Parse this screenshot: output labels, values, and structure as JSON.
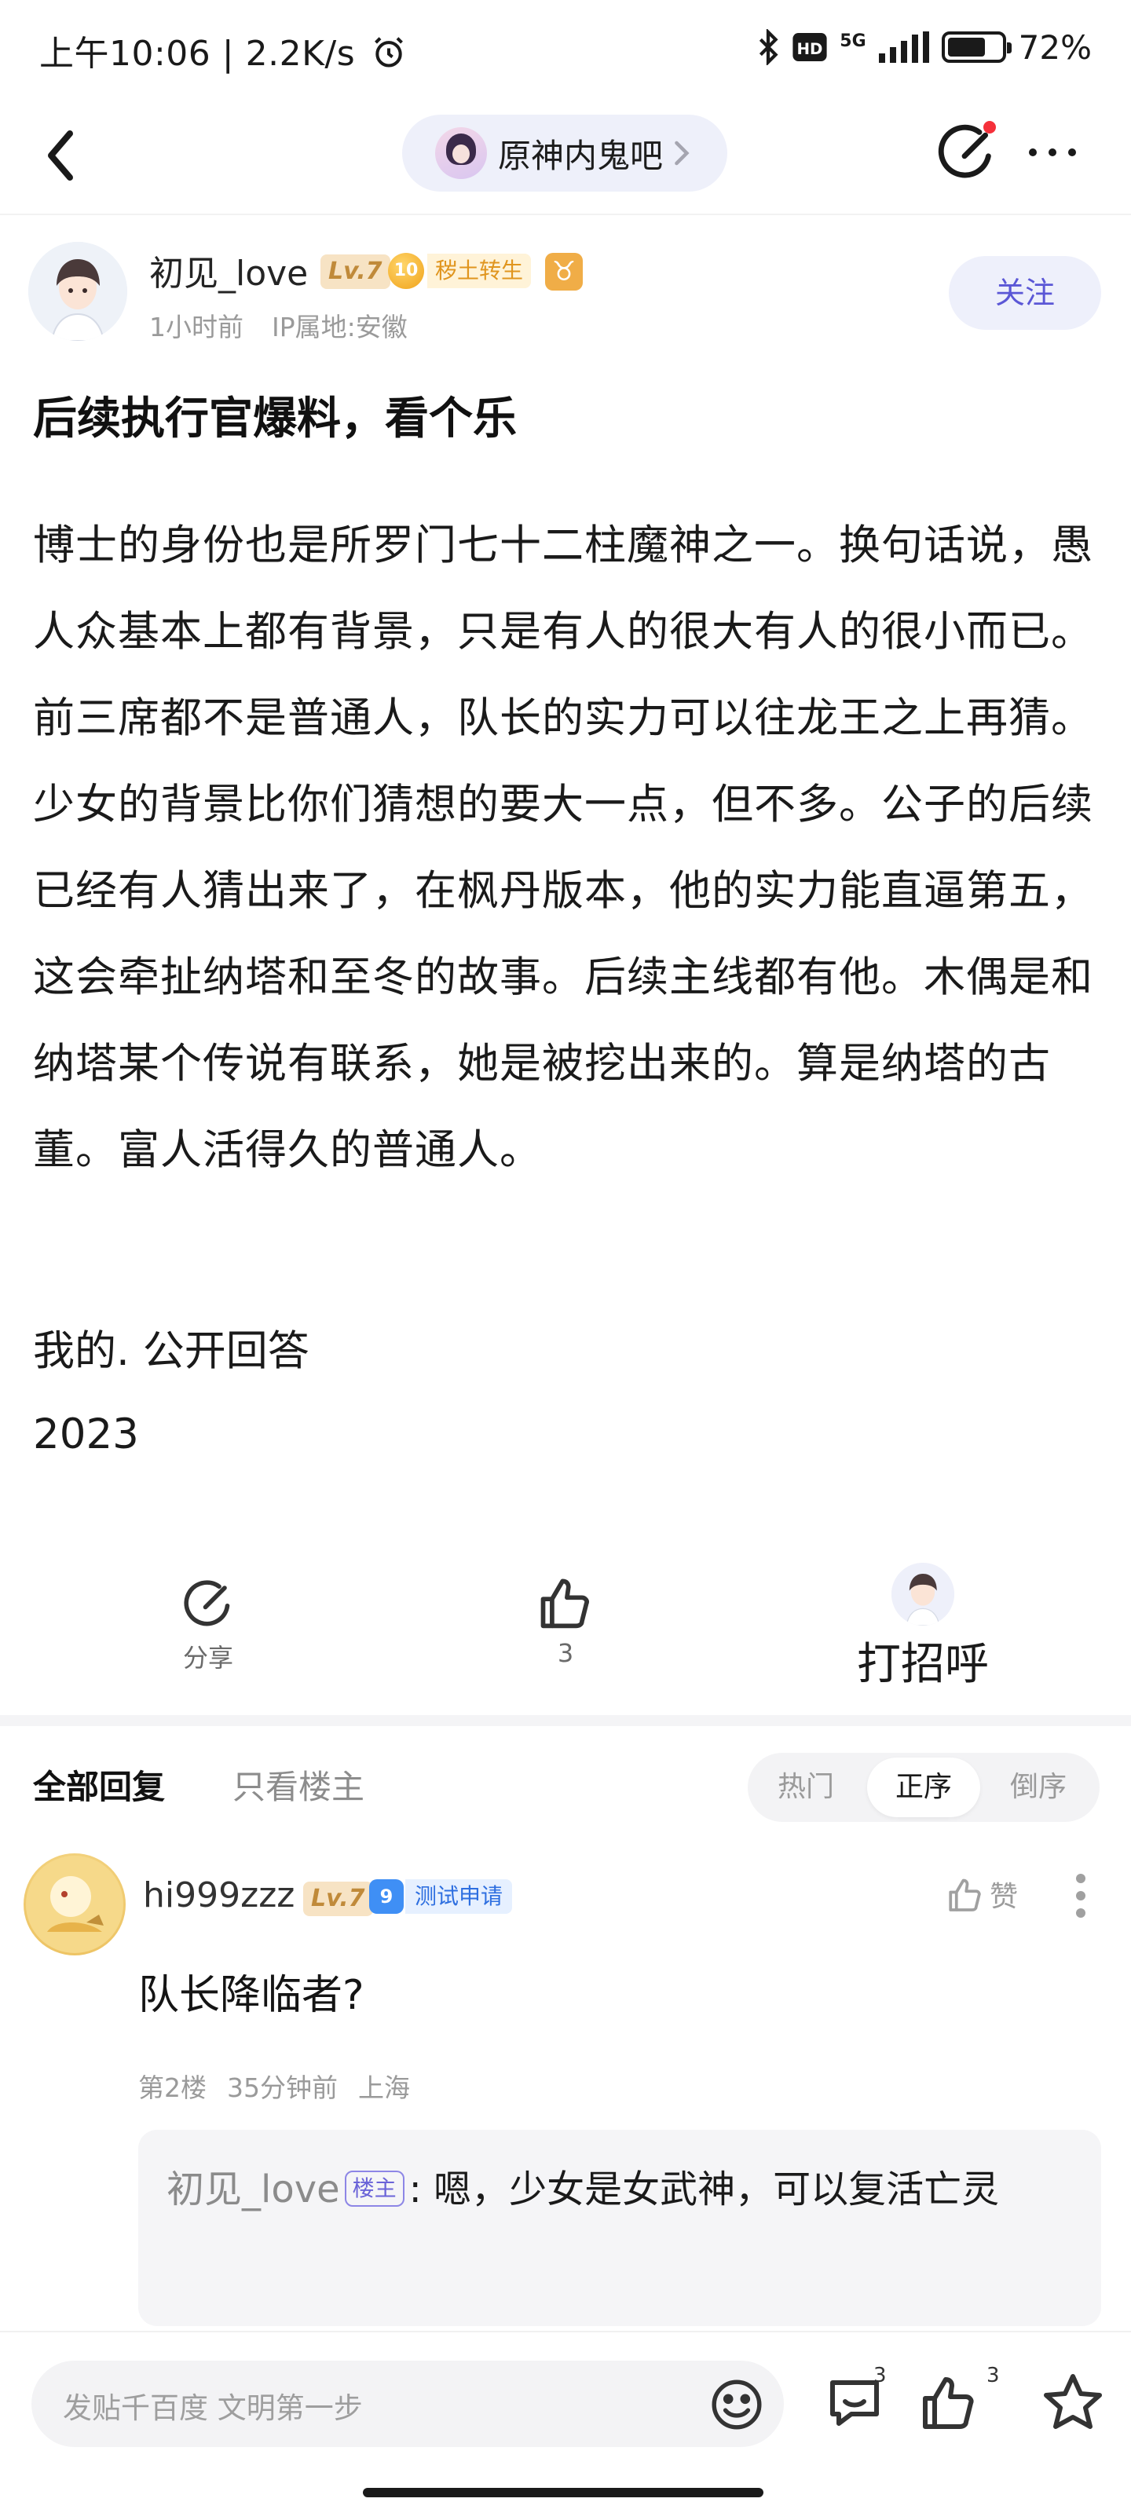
{
  "status_bar": {
    "time_speed": "上午10:06 | 2.2K/s",
    "network": "5G",
    "battery_level": 0.72,
    "battery_text": "72%",
    "icons": [
      "alarm-icon",
      "bluetooth-icon",
      "hd-icon",
      "signal-icon",
      "battery-icon"
    ]
  },
  "nav": {
    "forum_name": "原神内鬼吧",
    "icons": [
      "back-icon",
      "edit-share-icon",
      "more-icon"
    ]
  },
  "author": {
    "name": "初见_love",
    "level": "Lv.7",
    "rank_number": "10",
    "rank_title": "秽土转生",
    "zodiac": "♉",
    "time": "1小时前",
    "ip": "IP属地:安徽",
    "follow_label": "关注"
  },
  "post": {
    "title": "后续执行官爆料，看个乐",
    "body": "博士的身份也是所罗门七十二柱魔神之一。换句话说，愚人众基本上都有背景，只是有人的很大有人的很小而已。前三席都不是普通人，队长的实力可以往龙王之上再猜。少女的背景比你们猜想的要大一点，但不多。公子的后续已经有人猜出来了，在枫丹版本，他的实力能直逼第五，这会牵扯纳塔和至冬的故事。后续主线都有他。木偶是和纳塔某个传说有联系，她是被挖出来的。算是纳塔的古董。富人活得久的普通人。",
    "line_2": "我的. 公开回答",
    "line_3": "2023"
  },
  "actions": {
    "share_label": "分享",
    "like_count": "3",
    "greet_label": "打招呼"
  },
  "replies_header": {
    "all_label": "全部回复",
    "owner_only_label": "只看楼主",
    "sort_options": [
      "热门",
      "正序",
      "倒序"
    ],
    "sort_selected": "正序"
  },
  "comment": {
    "user": "hi999zzz",
    "level": "Lv.7",
    "badge_number": "9",
    "badge_title": "测试申请",
    "like_label": "赞",
    "text": "队长降临者?",
    "floor": "第2楼",
    "time": "35分钟前",
    "location": "上海",
    "sub_reply": {
      "user": "初见_love",
      "tag": "楼主",
      "text": ": 嗯，少女是女武神，可以复活亡灵"
    }
  },
  "bottom_bar": {
    "placeholder": "发贴千百度 文明第一步",
    "comment_count": "3",
    "like_count": "3",
    "icons": [
      "emoji-icon",
      "comment-icon",
      "like-icon",
      "star-icon"
    ]
  },
  "colors": {
    "accent": "#5b57d6",
    "level_badge": "#f7e3c4",
    "rank_badge": "#f0a21a",
    "notify_dot": "#f5303a"
  }
}
